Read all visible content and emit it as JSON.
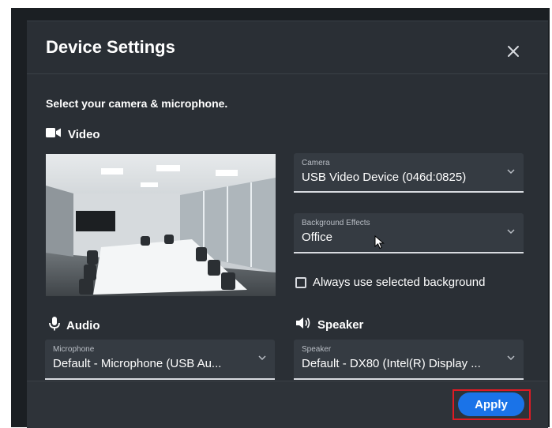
{
  "dialog": {
    "title": "Device Settings",
    "subtitle": "Select your camera & microphone."
  },
  "video": {
    "section_label": "Video",
    "camera": {
      "label": "Camera",
      "value": "USB Video Device (046d:0825)"
    },
    "background": {
      "label": "Background Effects",
      "value": "Office"
    },
    "always_use_label": "Always use selected background",
    "always_use_checked": false
  },
  "audio": {
    "section_label": "Audio",
    "microphone": {
      "label": "Microphone",
      "value": "Default - Microphone (USB Au..."
    }
  },
  "speaker": {
    "section_label": "Speaker",
    "device": {
      "label": "Speaker",
      "value": "Default - DX80 (Intel(R) Display ..."
    }
  },
  "footer": {
    "apply_label": "Apply"
  },
  "icons": {
    "close": "close-icon",
    "video": "video-camera-icon",
    "audio": "microphone-icon",
    "speaker": "speaker-icon",
    "chevron": "chevron-down-icon",
    "cursor": "mouse-cursor-icon"
  },
  "colors": {
    "dialog_bg": "#2a2f35",
    "accent": "#1a73e8",
    "highlight": "#e01b24"
  }
}
